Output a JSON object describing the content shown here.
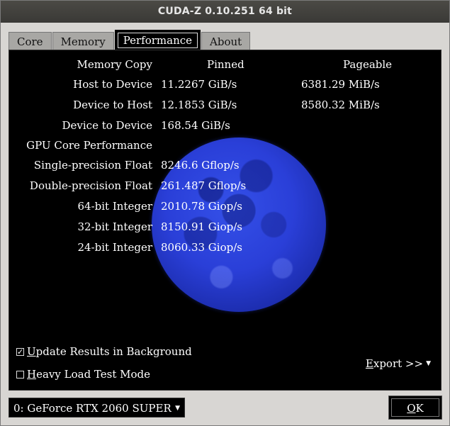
{
  "window": {
    "title": "CUDA-Z 0.10.251 64 bit"
  },
  "tabs": [
    {
      "label": "Core"
    },
    {
      "label": "Memory"
    },
    {
      "label": "Performance",
      "active": true
    },
    {
      "label": "About"
    }
  ],
  "performance": {
    "headers": {
      "memory_copy": "Memory Copy",
      "pinned": "Pinned",
      "pageable": "Pageable"
    },
    "memory_rows": [
      {
        "label": "Host to Device",
        "pinned": "11.2267 GiB/s",
        "pageable": "6381.29 MiB/s"
      },
      {
        "label": "Device to Host",
        "pinned": "12.1853 GiB/s",
        "pageable": "8580.32 MiB/s"
      },
      {
        "label": "Device to Device",
        "pinned": "168.54 GiB/s",
        "pageable": ""
      }
    ],
    "gpu_core_heading": "GPU Core Performance",
    "core_rows": [
      {
        "label": "Single-precision Float",
        "value": "8246.6 Gflop/s"
      },
      {
        "label": "Double-precision Float",
        "value": "261.487 Gflop/s"
      },
      {
        "label": "64-bit Integer",
        "value": "2010.78 Giop/s"
      },
      {
        "label": "32-bit Integer",
        "value": "8150.91 Giop/s"
      },
      {
        "label": "24-bit Integer",
        "value": "8060.33 Giop/s"
      }
    ],
    "options": {
      "update_background": {
        "label_u": "U",
        "label_rest": "pdate Results in Background",
        "checked": true
      },
      "heavy_load": {
        "label_u": "H",
        "label_rest": "eavy Load Test Mode",
        "checked": false
      }
    },
    "export": {
      "label_u": "E",
      "label_rest": "xport >>"
    }
  },
  "footer": {
    "device_selected": "0: GeForce RTX 2060 SUPER",
    "ok": {
      "label_u": "O",
      "label_rest": "K"
    }
  },
  "icons": {
    "check": "check-mark",
    "dropdown": "triangle-down"
  },
  "colors": {
    "panel_bg": "#000000",
    "text": "#ffffff",
    "window_bg": "#d8d6d3",
    "titlebar": "#3c3b37",
    "moon": "#2a3fd8"
  }
}
